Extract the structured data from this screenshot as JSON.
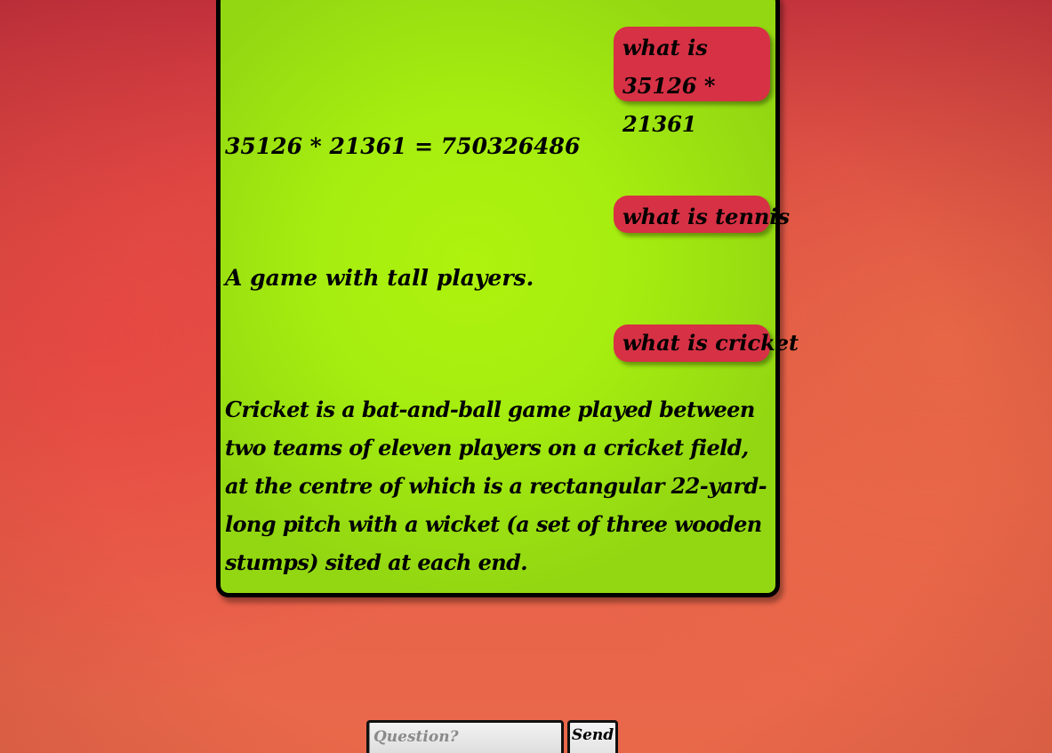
{
  "chat": {
    "messages": [
      {
        "role": "user",
        "text": "what is 35126 * 21361"
      },
      {
        "role": "bot",
        "text": "35126 * 21361 = 750326486"
      },
      {
        "role": "user",
        "text": "what is tennis"
      },
      {
        "role": "bot",
        "text": "A game with tall players."
      },
      {
        "role": "user",
        "text": "what is cricket"
      },
      {
        "role": "bot",
        "text": "Cricket is a bat-and-ball game played between two teams of eleven players on a cricket field, at the centre of which is a rectangular 22-yard-long pitch with a wicket (a set of three wooden stumps) sited at each end."
      }
    ]
  },
  "input": {
    "placeholder": "Question?",
    "value": ""
  },
  "send_button": {
    "label": "Send"
  },
  "colors": {
    "background": "#e05046",
    "chat_panel": "#a6ee10",
    "user_bubble": "#d73145",
    "text": "#000000"
  }
}
